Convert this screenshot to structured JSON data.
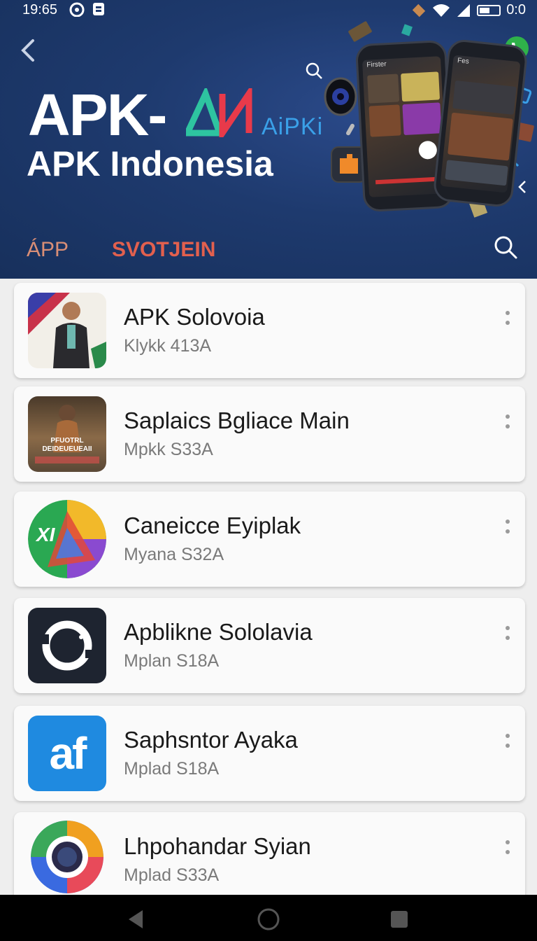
{
  "status_bar": {
    "time": "19:65",
    "right_text": "0:0",
    "icons": [
      "hotspot-icon",
      "notification-icon",
      "signal-icon",
      "wifi-icon",
      "cell-icon",
      "battery-icon"
    ]
  },
  "header": {
    "brand_title": "APK-",
    "brand_tag": "AiPKi",
    "brand_subtitle": "APK Indonesia",
    "tabs": [
      {
        "label": "ÁPP"
      },
      {
        "label": "SVOTJEIN"
      }
    ],
    "phone_label_1": "Firster",
    "phone_label_2": "Fes"
  },
  "apps": [
    {
      "name": "APK Solovoia",
      "meta": "Klykk 413A",
      "icon": "person-photo-icon"
    },
    {
      "name": "Saplaics Bgliace Main",
      "meta": "Mpkk S33A",
      "icon": "poster-photo-icon",
      "icon_text": "PFUOTRL DEIDEUEUEAII"
    },
    {
      "name": "Caneicce Eyiplak",
      "meta": "Myana S32A",
      "icon": "triangle-logo-icon",
      "icon_text": "XI"
    },
    {
      "name": "Apblikne Sololavia",
      "meta": "Mplan S18A",
      "icon": "ring-logo-icon"
    },
    {
      "name": "Saphsntor Ayaka",
      "meta": "Mplad S18A",
      "icon": "af-logo-icon",
      "icon_text": "af"
    },
    {
      "name": "Lhpohandar Syian",
      "meta": "Mplad S33A",
      "icon": "color-ring-logo-icon"
    }
  ],
  "colors": {
    "header_bg": "#1e3a6e",
    "accent_red": "#e2604e",
    "brand_green": "#2ec4a0",
    "brand_red": "#e83a4a",
    "brand_blue": "#3aa0e8"
  }
}
